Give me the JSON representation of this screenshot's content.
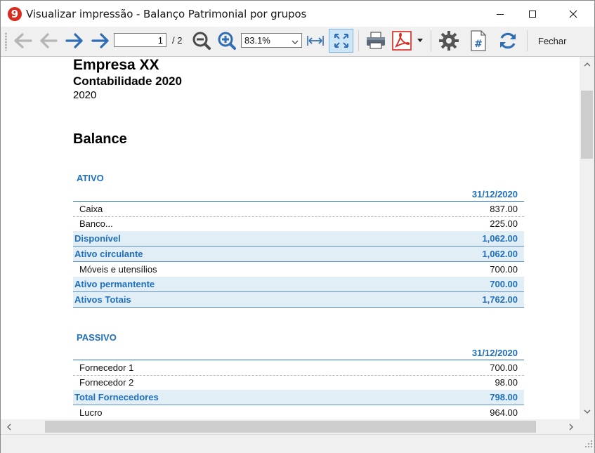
{
  "window": {
    "title": "Visualizar impressão - Balanço Patrimonial por grupos"
  },
  "toolbar": {
    "page_current": "1",
    "page_total": "/ 2",
    "zoom_value": "83.1%",
    "close_label": "Fechar"
  },
  "report": {
    "company": "Empresa XX",
    "subtitle": "Contabilidade 2020",
    "year": "2020",
    "heading": "Balance",
    "sections": [
      {
        "title": "ATIVO",
        "date_header": "31/12/2020",
        "rows": [
          {
            "label": "Caixa",
            "amount": "837.00",
            "kind": "detail"
          },
          {
            "label": "Banco...",
            "amount": "225.00",
            "kind": "detail"
          },
          {
            "label": "Disponível",
            "amount": "1,062.00",
            "kind": "total"
          },
          {
            "label": "Ativo circulante",
            "amount": "1,062.00",
            "kind": "total"
          },
          {
            "label": "Móveis e utensílios",
            "amount": "700.00",
            "kind": "detail"
          },
          {
            "label": "Ativo permantente",
            "amount": "700.00",
            "kind": "total"
          },
          {
            "label": "Ativos Totais",
            "amount": "1,762.00",
            "kind": "total"
          }
        ]
      },
      {
        "title": "PASSIVO",
        "date_header": "31/12/2020",
        "rows": [
          {
            "label": "Fornecedor 1",
            "amount": "700.00",
            "kind": "detail"
          },
          {
            "label": "Fornecedor 2",
            "amount": "98.00",
            "kind": "detail"
          },
          {
            "label": "Total Fornecedores",
            "amount": "798.00",
            "kind": "total"
          },
          {
            "label": "Lucro",
            "amount": "964.00",
            "kind": "detail"
          }
        ]
      }
    ]
  },
  "colors": {
    "accent": "#1f6fbf",
    "total_row_bg": "#e1eef6",
    "arrow_blue": "#2f6db5",
    "pdf_red": "#d7261e"
  },
  "icons": {
    "app": "app-logo-icon",
    "first": "first-page-icon",
    "prev": "previous-page-icon",
    "next": "next-page-icon",
    "last": "last-page-icon",
    "zoom_out": "zoom-out-icon",
    "zoom_in": "zoom-in-icon",
    "fit_width": "fit-width-icon",
    "fit_page": "fit-page-icon",
    "print": "print-icon",
    "pdf": "pdf-icon",
    "settings": "gear-icon",
    "page_number": "page-number-icon",
    "refresh": "refresh-icon"
  }
}
